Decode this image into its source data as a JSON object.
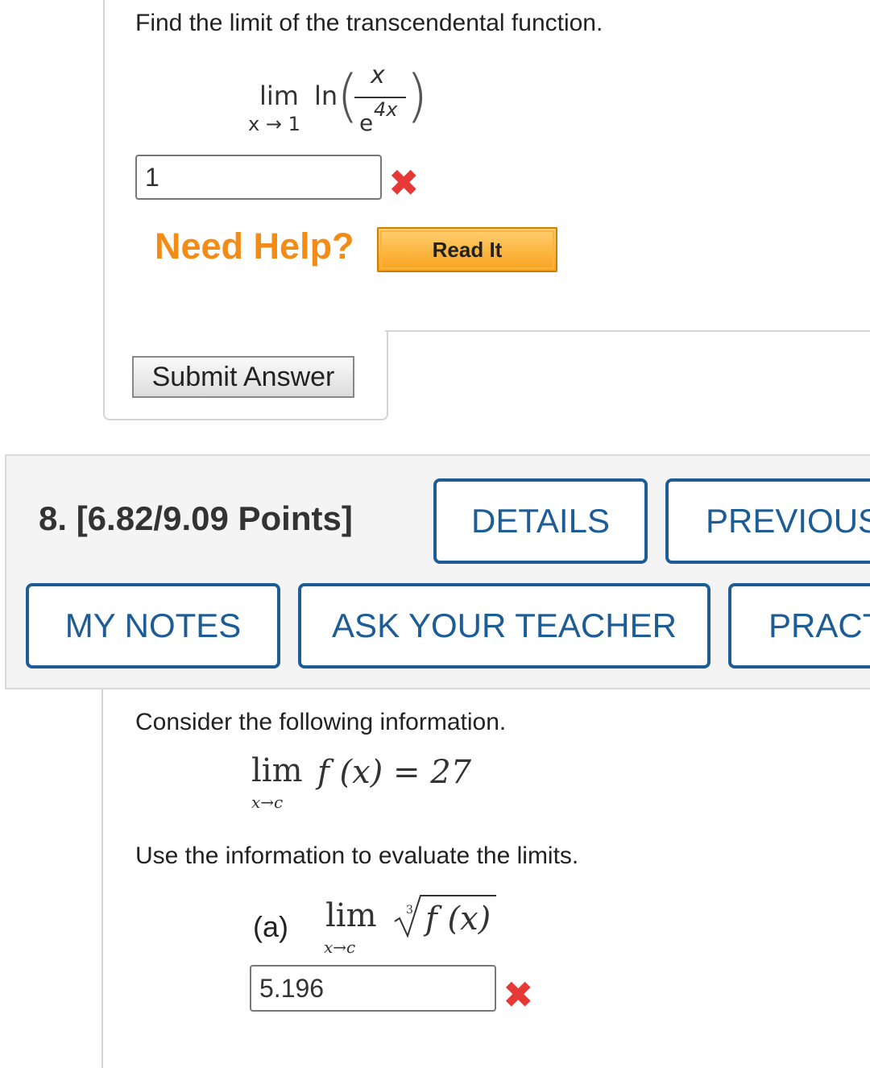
{
  "q7": {
    "prompt": "Find the limit of the transcendental function.",
    "expr": {
      "lim": "lim",
      "sub": "x → 1",
      "fn": "ln",
      "num": "x",
      "den_base": "e",
      "den_exp": "4x"
    },
    "answer_value": "1",
    "answer_status": "✖",
    "need_help": "Need Help?",
    "read_it": "Read It",
    "submit": "Submit Answer"
  },
  "q8": {
    "title": "8.  [6.82/9.09 Points]",
    "buttons": {
      "details": "DETAILS",
      "previous": "PREVIOUS",
      "my_notes": "MY NOTES",
      "ask_teacher": "ASK YOUR TEACHER",
      "practice": "PRACT"
    },
    "consider": "Consider the following information.",
    "given": {
      "lim": "lim",
      "sub": "x→c",
      "expr": "f (x) = 27"
    },
    "instruction": "Use the information to evaluate the limits.",
    "part_a": {
      "label": "(a)",
      "lim": "lim",
      "sub": "x→c",
      "root_index": "3",
      "radicand": "f (x)",
      "answer_value": "5.196",
      "answer_status": "✖"
    }
  },
  "colors": {
    "accent": "#1d5c95",
    "help_orange": "#f28c16",
    "wrong_red": "#e53935"
  }
}
